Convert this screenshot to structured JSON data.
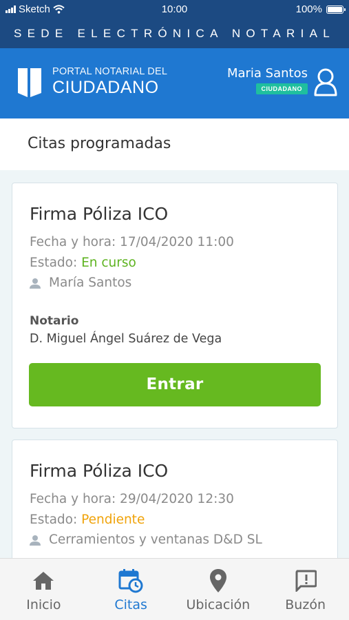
{
  "status_bar": {
    "carrier": "Sketch",
    "time": "10:00",
    "battery": "100%"
  },
  "sede_title": "SEDE ELECTRÓNICA NOTARIAL",
  "portal": {
    "logo_sub": "PORTAL NOTARIAL DEL",
    "logo_main": "CIUDADANO",
    "user_name": "Maria Santos",
    "role_badge": "CIUDADANO"
  },
  "section_title": "Citas programadas",
  "appointments": [
    {
      "title": "Firma Póliza ICO",
      "datetime": "Fecha y hora: 17/04/2020 11:00",
      "status_label": "Estado: ",
      "status_value": "En curso",
      "person": "María Santos",
      "notario_label": "Notario",
      "notario_name": "D. Miguel Ángel Suárez de Vega",
      "button_label": "Entrar"
    },
    {
      "title": "Firma Póliza ICO",
      "datetime": "Fecha y hora: 29/04/2020 12:30",
      "status_label": "Estado: ",
      "status_value": "Pendiente",
      "person": "Cerramientos y ventanas D&D SL"
    }
  ],
  "bottom_nav": [
    {
      "label": "Inicio",
      "icon": "home-icon"
    },
    {
      "label": "Citas",
      "icon": "calendar-clock-icon",
      "active": true
    },
    {
      "label": "Ubicación",
      "icon": "location-pin-icon"
    },
    {
      "label": "Buzón",
      "icon": "message-alert-icon"
    }
  ],
  "colors": {
    "dark_blue": "#1c4a82",
    "brand_blue": "#1f78d1",
    "badge_teal": "#1fbf9e",
    "status_green": "#5db31f",
    "status_orange": "#f0a30a",
    "button_green": "#66b920"
  }
}
